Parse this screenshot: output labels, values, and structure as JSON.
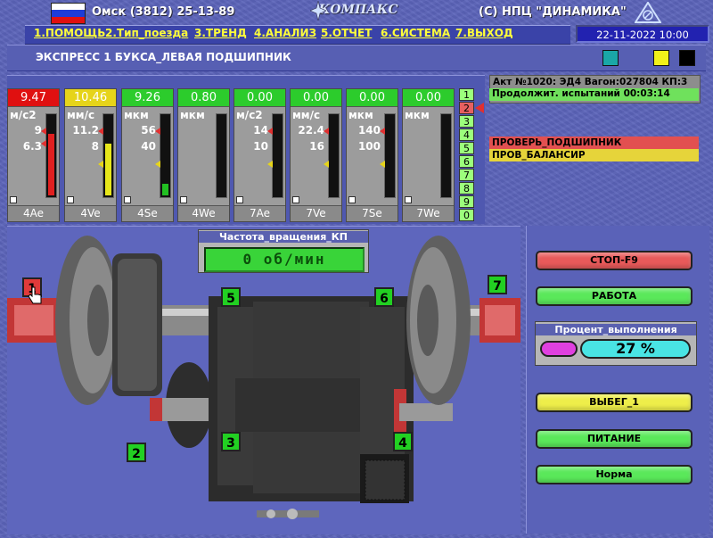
{
  "header": {
    "phone_text": "Омск (3812) 25-13-89",
    "logo_text": "КОМПАКС",
    "copyright_text": "(С) НПЦ \"ДИНАМИКА\"",
    "flag_colors": [
      "#ffffff",
      "#1d3cd8",
      "#e01010"
    ]
  },
  "menu": {
    "items": [
      {
        "label": "1.ПОМОЩЬ"
      },
      {
        "label": "2.Тип_поезда"
      },
      {
        "label": "3.ТРЕНД"
      },
      {
        "label": "4.АНАЛИЗ"
      },
      {
        "label": "5.ОТЧЕТ"
      },
      {
        "label": "6.СИСТЕМА"
      },
      {
        "label": "7.ВЫХОД"
      }
    ],
    "datetime": "22-11-2022 10:00"
  },
  "subheader": {
    "title": "ЭКСПРЕСС 1 БУКСА_ЛЕВАЯ ПОДШИПНИК",
    "color_squares": [
      "#1aa7a7",
      "#f2f21a",
      "#000000"
    ]
  },
  "channels": [
    {
      "value": "9.47",
      "unit": "м/с2",
      "th_high": "9",
      "th_low": "6.3",
      "label": "4Ae",
      "header_color": "#e01010",
      "fill_color": "#e02020",
      "fill_fraction": 0.78,
      "marker_color": "#e03030",
      "marker_fraction": 0.66
    },
    {
      "value": "10.46",
      "unit": "мм/с",
      "th_high": "11.2",
      "th_low": "8",
      "label": "4Ve",
      "header_color": "#e6d41a",
      "fill_color": "#e6e61a",
      "fill_fraction": 0.65,
      "marker_color": "#e6d41a",
      "marker_fraction": 0.4
    },
    {
      "value": "9.26",
      "unit": "мкм",
      "th_high": "56",
      "th_low": "40",
      "label": "4Se",
      "header_color": "#2ccc2c",
      "fill_color": "#22c022",
      "fill_fraction": 0.15,
      "marker_color": "#e6d41a",
      "marker_fraction": 0.4
    },
    {
      "value": "0.80",
      "unit": "мкм",
      "th_high": "",
      "th_low": "",
      "label": "4We",
      "header_color": "#2ccc2c",
      "fill_color": "#22c022",
      "fill_fraction": 0,
      "marker_color": "",
      "marker_fraction": 0
    },
    {
      "value": "0.00",
      "unit": "м/с2",
      "th_high": "14",
      "th_low": "10",
      "label": "7Ae",
      "header_color": "#2ccc2c",
      "fill_color": "#22c022",
      "fill_fraction": 0,
      "marker_color": "#e6d41a",
      "marker_fraction": 0.4
    },
    {
      "value": "0.00",
      "unit": "мм/с",
      "th_high": "22.4",
      "th_low": "16",
      "label": "7Ve",
      "header_color": "#2ccc2c",
      "fill_color": "#22c022",
      "fill_fraction": 0,
      "marker_color": "#e6d41a",
      "marker_fraction": 0.4
    },
    {
      "value": "0.00",
      "unit": "мкм",
      "th_high": "140",
      "th_low": "100",
      "label": "7Se",
      "header_color": "#2ccc2c",
      "fill_color": "#22c022",
      "fill_fraction": 0,
      "marker_color": "#e6d41a",
      "marker_fraction": 0.4
    },
    {
      "value": "0.00",
      "unit": "мкм",
      "th_high": "",
      "th_low": "",
      "label": "7We",
      "header_color": "#2ccc2c",
      "fill_color": "#22c022",
      "fill_fraction": 0,
      "marker_color": "",
      "marker_fraction": 0
    }
  ],
  "channel_numbers": [
    "1",
    "2",
    "3",
    "4",
    "5",
    "6",
    "7",
    "8",
    "9",
    "0"
  ],
  "info": {
    "act_line1": "Акт №1020: ЭД4 Вагон:027804 КП:3",
    "act_line2": "Продолжит. испытаний 00:03:14",
    "warnings": [
      {
        "text": "ПРОВЕРЬ_ПОДШИПНИК",
        "color": "#e25050"
      },
      {
        "text": "ПРОВ_БАЛАНСИР",
        "color": "#e6d43a"
      }
    ]
  },
  "rpm": {
    "title": "Частота_вращения_КП",
    "value": "0  об/мин"
  },
  "sensors": [
    {
      "label": "1",
      "color": "#e03a3a"
    },
    {
      "label": "2",
      "color": "#22d022"
    },
    {
      "label": "3",
      "color": "#22d022"
    },
    {
      "label": "4",
      "color": "#22d022"
    },
    {
      "label": "5",
      "color": "#22d022"
    },
    {
      "label": "6",
      "color": "#22d022"
    },
    {
      "label": "7",
      "color": "#22d022"
    }
  ],
  "buttons": {
    "stop": {
      "label": "СТОП-F9",
      "color": "#e85a5a"
    },
    "work": {
      "label": "РАБОТА",
      "color": "#5ae85a"
    },
    "coast": {
      "label": "ВЫБЕГ_1",
      "color": "#eeee4a"
    },
    "power": {
      "label": "ПИТАНИЕ",
      "color": "#5ae85a"
    },
    "normal": {
      "label": "Норма",
      "color": "#5ae85a"
    }
  },
  "progress": {
    "title": "Процент_выполнения",
    "value_text": "27 %",
    "percent": 27
  }
}
